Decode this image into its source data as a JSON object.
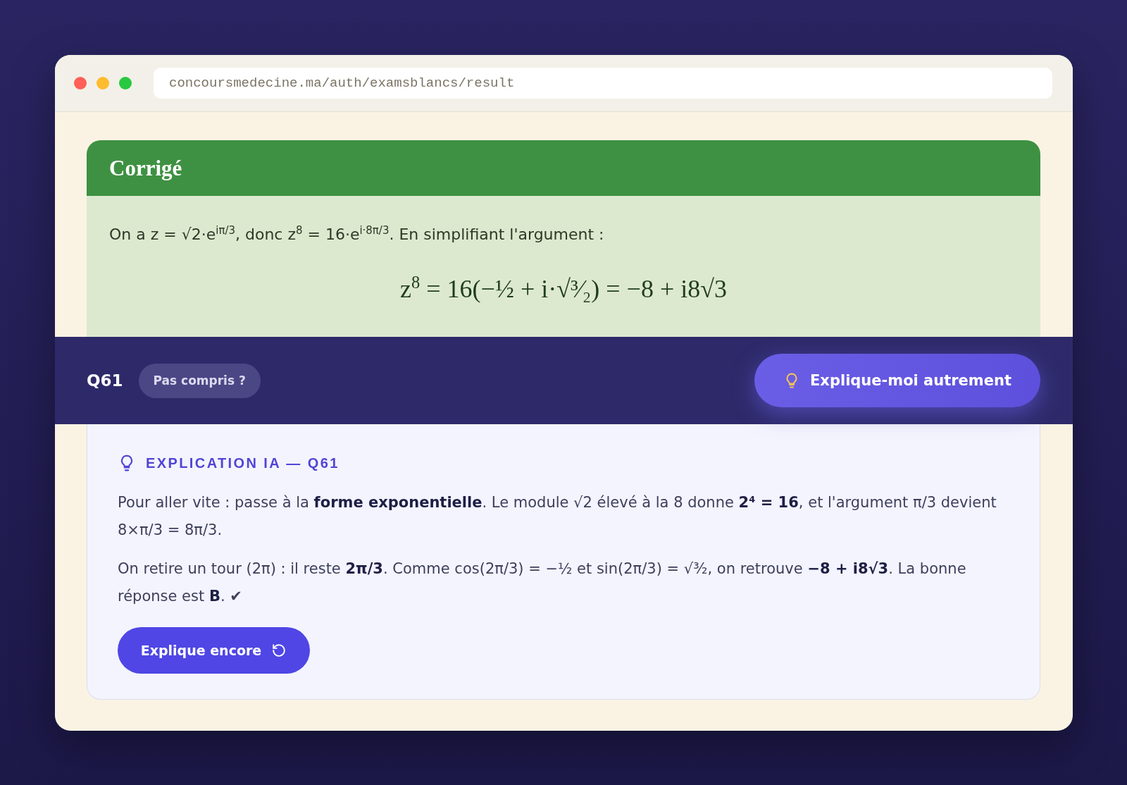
{
  "browser": {
    "url": "concoursmedecine.ma/auth/examsblancs/result"
  },
  "corrige": {
    "title": "Corrigé",
    "text": "On a z = √2·e$^{iπ/3}$, donc z$^{8}$ = 16·e$^{i·8π/3}$. En simplifiant l'argument :",
    "formula": "z$^{8}$ = 16(−½ + i·√³⁄₂) = −8 + i8√3"
  },
  "question_bar": {
    "label": "Q61",
    "badge": "Pas compris ?",
    "button": "Explique-moi autrement"
  },
  "explanation": {
    "heading": "EXPLICATION IA — Q61",
    "paragraphs": [
      "Pour aller vite : passe à la **forme exponentielle**. Le module √2 élevé à la 8 donne **2⁴ = 16**, et l'argument π/3 devient 8×π/3 = 8π/3.",
      "On retire un tour (2π) : il reste **2π/3**. Comme cos(2π/3) = −½ et sin(2π/3) = √³⁄₂, on retrouve **−8 + i8√3**. La bonne réponse est **B**. ✔"
    ],
    "button": "Explique encore"
  }
}
